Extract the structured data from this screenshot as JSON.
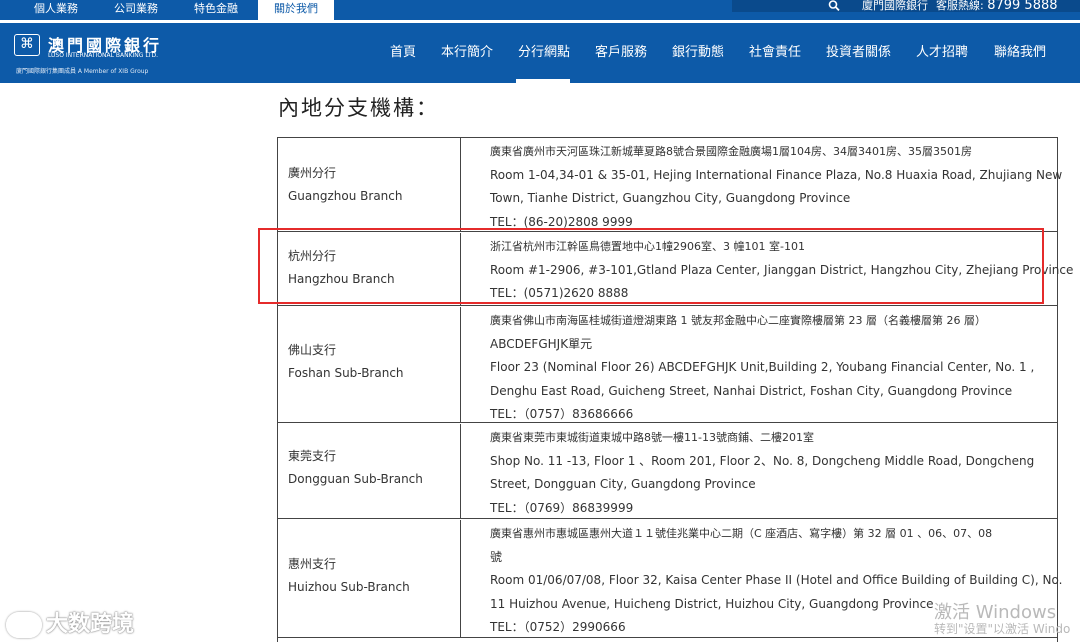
{
  "topbar": {
    "links": [
      "個人業務",
      "公司業務",
      "特色金融",
      "關於我們"
    ],
    "active_index": 3,
    "search_icon": "search-icon",
    "corp_name": "廈門國際銀行",
    "hotline_label": "客服熱線:",
    "hotline_number": "8799 5888"
  },
  "logo": {
    "mark": "⌘",
    "name_zh": "澳門國際銀行",
    "name_en": "LUSO INTERNATIONAL BANKING LTD.",
    "group_line": "廈門國際銀行集團成員 A Member of XIB Group"
  },
  "nav": {
    "items": [
      "首頁",
      "本行簡介",
      "分行網點",
      "客戶服務",
      "銀行動態",
      "社會責任",
      "投資者關係",
      "人才招聘",
      "聯絡我們"
    ],
    "active_index": 2
  },
  "page": {
    "title": "內地分支機構："
  },
  "branches": [
    {
      "name_zh": "廣州分行",
      "name_en": "Guangzhou Branch",
      "lines": [
        "廣東省廣州市天河區珠江新城華夏路8號合景國際金融廣場1層104房、34層3401房、35層3501房",
        "Room 1-04,34-01 & 35-01, Hejing International Finance Plaza, No.8 Huaxia Road, Zhujiang New",
        "Town, Tianhe District, Guangzhou City, Guangdong Province",
        "TEL：(86-20)2808 9999"
      ]
    },
    {
      "name_zh": "杭州分行",
      "name_en": "Hangzhou Branch",
      "lines": [
        "浙江省杭州市江幹區鳥德置地中心1幢2906室、3 幢101 室-101",
        "Room #1-2906, #3-101,Gtland Plaza Center, Jianggan District, Hangzhou City, Zhejiang Province",
        "TEL：(0571)2620 8888"
      ]
    },
    {
      "name_zh": "佛山支行",
      "name_en": "Foshan Sub-Branch",
      "lines": [
        "廣東省佛山市南海區桂城街道燈湖東路 1 號友邦金融中心二座實際樓層第 23 層（名義樓層第 26 層）",
        "ABCDEFGHJK單元",
        "Floor 23 (Nominal Floor 26) ABCDEFGHJK Unit,Building 2, Youbang Financial Center, No. 1 ,",
        "Denghu East Road, Guicheng Street, Nanhai District, Foshan City, Guangdong Province",
        "TEL：（0757）83686666"
      ]
    },
    {
      "name_zh": "東莞支行",
      "name_en": "Dongguan Sub-Branch",
      "lines": [
        "廣東省東莞市東城街道東城中路8號一樓11-13號商鋪、二樓201室",
        "Shop No. 11 -13, Floor 1 、Room 201, Floor 2、No. 8, Dongcheng Middle Road, Dongcheng",
        "Street, Dongguan City, Guangdong Province",
        "TEL：（0769）86839999"
      ]
    },
    {
      "name_zh": "惠州支行",
      "name_en": "Huizhou Sub-Branch",
      "lines": [
        "廣東省惠州市惠城區惠州大道１１號佳兆業中心二期（C 座酒店、寫字樓）第 32 層 01 、06、07、08",
        "號",
        "Room 01/06/07/08, Floor 32, Kaisa Center Phase II (Hotel and Office Building of Building C), No.",
        "11 Huizhou Avenue, Huicheng District, Huizhou City, Guangdong Province",
        "TEL：（0752）2990666"
      ]
    }
  ],
  "overlay": {
    "watermark": "大数跨境",
    "windows_activate": "激活 Windows",
    "windows_activate_hint": "转到\"设置\"以激活 Windo"
  },
  "colors": {
    "brand_blue": "#0d5aa8",
    "highlight_red": "#e52b2b"
  }
}
